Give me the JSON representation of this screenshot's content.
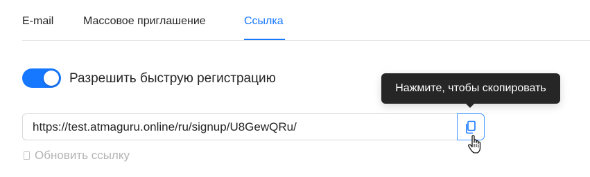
{
  "tabs": [
    {
      "label": "E-mail",
      "active": false
    },
    {
      "label": "Массовое приглашение",
      "active": false
    },
    {
      "label": "Ссылка",
      "active": true
    }
  ],
  "quick_signup": {
    "label": "Разрешить быструю регистрацию",
    "enabled": true
  },
  "tooltip": {
    "text": "Нажмите, чтобы скопировать"
  },
  "link": {
    "value": "https://test.atmaguru.online/ru/signup/U8GewQRu/"
  },
  "refresh": {
    "label": "Обновить ссылку"
  },
  "colors": {
    "accent": "#1677ff",
    "tooltip_bg": "#262626",
    "muted": "#b3b3b3"
  },
  "icons": {
    "copy": "copy-icon",
    "cursor": "hand-pointer-icon",
    "refresh": "refresh-icon"
  }
}
